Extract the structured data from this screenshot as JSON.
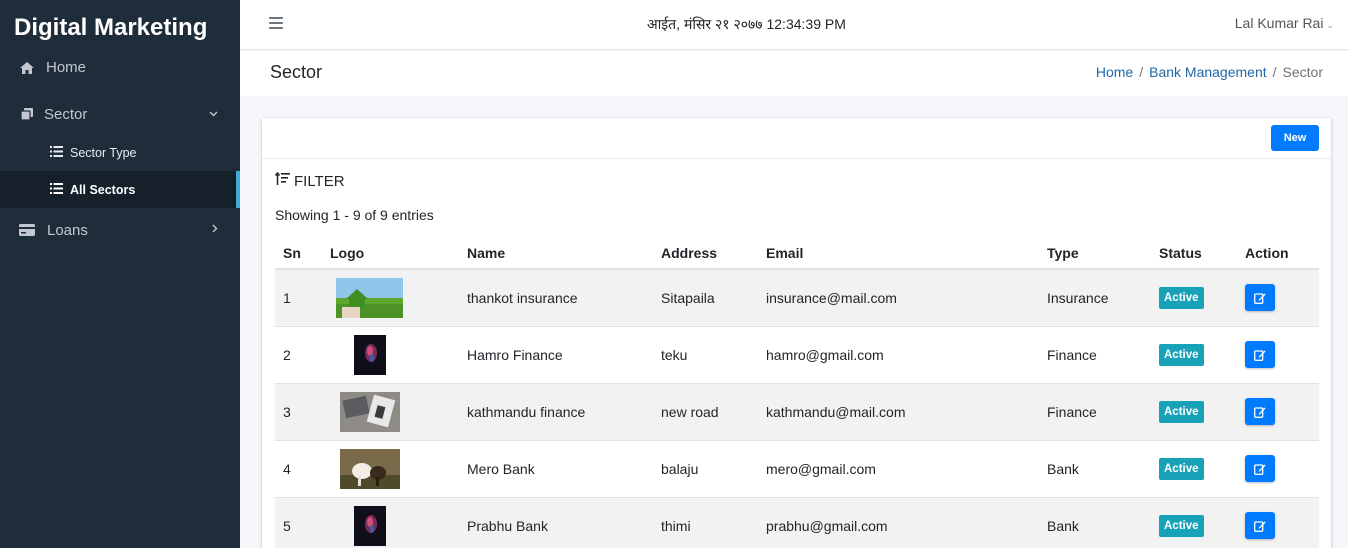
{
  "sidebar": {
    "brand": "Digital Marketing",
    "home_label": "Home",
    "sector_label": "Sector",
    "sector_items": [
      "Sector Type",
      "All Sectors"
    ],
    "loans_label": "Loans"
  },
  "topbar": {
    "datetime": "आईत, मंसिर २१ २०७७ 12:34:39 PM",
    "user": "Lal Kumar Rai"
  },
  "header": {
    "title": "Sector",
    "breadcrumb": [
      "Home",
      "Bank Management",
      "Sector"
    ]
  },
  "card": {
    "new_label": "New",
    "filter_label": "FILTER",
    "showing": "Showing 1 - 9 of 9 entries"
  },
  "table": {
    "columns": [
      "Sn",
      "Logo",
      "Name",
      "Address",
      "Email",
      "Type",
      "Status",
      "Action"
    ],
    "rows": [
      {
        "sn": "1",
        "name": "thankot insurance",
        "address": "Sitapaila",
        "email": "insurance@mail.com",
        "type": "Insurance",
        "status": "Active",
        "logo": "green-field-house"
      },
      {
        "sn": "2",
        "name": "Hamro Finance",
        "address": "teku",
        "email": "hamro@gmail.com",
        "type": "Finance",
        "status": "Active",
        "logo": "dark-smoke"
      },
      {
        "sn": "3",
        "name": "kathmandu finance",
        "address": "new road",
        "email": "kathmandu@mail.com",
        "type": "Finance",
        "status": "Active",
        "logo": "desk-laptop"
      },
      {
        "sn": "4",
        "name": "Mero Bank",
        "address": "balaju",
        "email": "mero@gmail.com",
        "type": "Bank",
        "status": "Active",
        "logo": "horses"
      },
      {
        "sn": "5",
        "name": "Prabhu Bank",
        "address": "thimi",
        "email": "prabhu@gmail.com",
        "type": "Bank",
        "status": "Active",
        "logo": "dark-smoke"
      }
    ]
  },
  "colors": {
    "sidebar_bg": "#1f2d3a",
    "primary": "#007bff",
    "status_active": "#17a2b8",
    "link": "#2168a8"
  }
}
